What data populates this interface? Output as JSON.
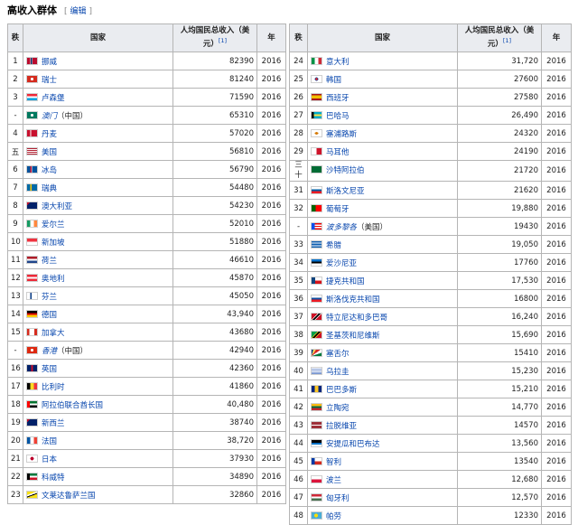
{
  "section": {
    "title": "高收入群体",
    "edit_open": "[",
    "edit_label": "编辑",
    "edit_close": "]"
  },
  "headers": {
    "rank": "秩",
    "country": "国家",
    "income": "人均国民总收入（美元）",
    "income_ref": "[1]",
    "year": "年"
  },
  "left_rows": [
    {
      "rank": "1",
      "country": "挪威",
      "income": "82390",
      "year": "2016",
      "flag": "linear-gradient(90deg,#ba0c2f 0 30%,#fff 30% 36%,#00205b 36% 48%,#fff 48% 54%,#ba0c2f 54%)"
    },
    {
      "rank": "2",
      "country": "瑞士",
      "income": "81240",
      "year": "2016",
      "flag": "radial-gradient(circle,#fff 0 25%,#d52b1e 26%)"
    },
    {
      "rank": "3",
      "country": "卢森堡",
      "income": "71590",
      "year": "2016",
      "flag": "linear-gradient(#ed2939 0 33%,#fff 33% 66%,#00a1de 66%)"
    },
    {
      "rank": "-",
      "country": "澳门",
      "italic": true,
      "note": "（中国）",
      "income": "65310",
      "year": "2016",
      "flag": "radial-gradient(circle,#fff 0 25%,#00785e 26%)"
    },
    {
      "rank": "4",
      "country": "丹麦",
      "income": "57020",
      "year": "2016",
      "flag": "linear-gradient(90deg,#c8102e 0 30%,#fff 30% 42%,#c8102e 42%)"
    },
    {
      "rank": "五",
      "country": "美国",
      "income": "56810",
      "year": "2016",
      "flag": "linear-gradient(#b22234 0 14%,#fff 14% 28%,#b22234 28% 42%,#fff 42% 57%,#b22234 57% 71%,#fff 71% 85%,#b22234 85%)"
    },
    {
      "rank": "6",
      "country": "冰岛",
      "income": "56790",
      "year": "2016",
      "flag": "linear-gradient(90deg,#02529c 0 30%,#fff 30% 34%,#dc1e35 34% 44%,#fff 44% 48%,#02529c 48%)"
    },
    {
      "rank": "7",
      "country": "瑞典",
      "income": "54480",
      "year": "2016",
      "flag": "linear-gradient(90deg,#006aa7 0 30%,#fecc00 30% 44%,#006aa7 44%)"
    },
    {
      "rank": "8",
      "country": "澳大利亚",
      "income": "54230",
      "year": "2016",
      "flag": "linear-gradient(135deg,#c8102e 0 18%,#012169 18%)"
    },
    {
      "rank": "9",
      "country": "爱尔兰",
      "income": "52010",
      "year": "2016",
      "flag": "linear-gradient(90deg,#169b62 0 33%,#fff 33% 66%,#ff883e 66%)"
    },
    {
      "rank": "10",
      "country": "新加坡",
      "income": "51880",
      "year": "2016",
      "flag": "linear-gradient(#ef3340 0 50%,#fff 50%)"
    },
    {
      "rank": "11",
      "country": "荷兰",
      "income": "46610",
      "year": "2016",
      "flag": "linear-gradient(#ae1c28 0 33%,#fff 33% 66%,#21468b 66%)"
    },
    {
      "rank": "12",
      "country": "奥地利",
      "income": "45870",
      "year": "2016",
      "flag": "linear-gradient(#ed2939 0 33%,#fff 33% 66%,#ed2939 66%)"
    },
    {
      "rank": "13",
      "country": "芬兰",
      "income": "45050",
      "year": "2016",
      "flag": "linear-gradient(90deg,#fff 0 30%,#003580 30% 44%,#fff 44%)"
    },
    {
      "rank": "14",
      "country": "德国",
      "income": "43,940",
      "year": "2016",
      "flag": "linear-gradient(#000 0 33%,#dd0000 33% 66%,#ffce00 66%)"
    },
    {
      "rank": "15",
      "country": "加拿大",
      "income": "43680",
      "year": "2016",
      "flag": "linear-gradient(90deg,#d52b1e 0 25%,#fff 25% 75%,#d52b1e 75%)"
    },
    {
      "rank": "-",
      "country": "香港",
      "italic": true,
      "note": "（中国）",
      "income": "42940",
      "year": "2016",
      "flag": "radial-gradient(circle,#fff 0 25%,#de2910 26%)"
    },
    {
      "rank": "16",
      "country": "英国",
      "income": "42360",
      "year": "2016",
      "flag": "linear-gradient(90deg,#012169 0 40%,#c8102e 40% 60%,#012169 60%)"
    },
    {
      "rank": "17",
      "country": "比利时",
      "income": "41860",
      "year": "2016",
      "flag": "linear-gradient(90deg,#000 0 33%,#fdda24 33% 66%,#ef3340 66%)"
    },
    {
      "rank": "18",
      "country": "阿拉伯联合酋长国",
      "income": "40,480",
      "year": "2016",
      "flag": "linear-gradient(90deg,#ff0000 0 26%,transparent 26%),linear-gradient(#00732f 0 33%,#fff 33% 66%,#000 66%)"
    },
    {
      "rank": "19",
      "country": "新西兰",
      "income": "38740",
      "year": "2016",
      "flag": "linear-gradient(135deg,#c8102e 0 18%,#012169 18%)"
    },
    {
      "rank": "20",
      "country": "法国",
      "income": "38,720",
      "year": "2016",
      "flag": "linear-gradient(90deg,#0055a4 0 33%,#fff 33% 66%,#ef4135 66%)"
    },
    {
      "rank": "21",
      "country": "日本",
      "income": "37930",
      "year": "2016",
      "flag": "radial-gradient(circle,#bc002d 0 28%,#fff 30%)"
    },
    {
      "rank": "22",
      "country": "科威特",
      "income": "34890",
      "year": "2016",
      "flag": "linear-gradient(90deg,#000 0 26%,transparent 26%),linear-gradient(#007a3d 0 33%,#fff 33% 66%,#ce1126 66%)"
    },
    {
      "rank": "23",
      "country": "文莱达鲁萨兰国",
      "income": "32860",
      "year": "2016",
      "flag": "linear-gradient(160deg,#f7e017 0 35%,#fff 35% 50%,#000 50% 60%,#f7e017 60%)"
    }
  ],
  "right_rows": [
    {
      "rank": "24",
      "country": "意大利",
      "income": "31,720",
      "year": "2016",
      "flag": "linear-gradient(90deg,#009246 0 33%,#fff 33% 66%,#ce2b37 66%)"
    },
    {
      "rank": "25",
      "country": "韩国",
      "income": "27600",
      "year": "2016",
      "flag": "radial-gradient(circle,#cd2e3a 0 20%,#0047a0 20% 28%,#fff 30%)"
    },
    {
      "rank": "26",
      "country": "西班牙",
      "income": "27580",
      "year": "2016",
      "flag": "linear-gradient(#aa151b 0 25%,#f1bf00 25% 75%,#aa151b 75%)"
    },
    {
      "rank": "27",
      "country": "巴哈马",
      "income": "26,490",
      "year": "2016",
      "flag": "linear-gradient(90deg,#000 0 25%,transparent 25%),linear-gradient(#00abc9 0 33%,#fae042 33% 66%,#00abc9 66%)"
    },
    {
      "rank": "28",
      "country": "塞浦路斯",
      "income": "24320",
      "year": "2016",
      "flag": "radial-gradient(ellipse,#d57800 0 25%,#fff 28%)"
    },
    {
      "rank": "29",
      "country": "马耳他",
      "income": "24190",
      "year": "2016",
      "flag": "linear-gradient(90deg,#fff 0 50%,#cf142b 50%)"
    },
    {
      "rank": "三十",
      "country": "沙特阿拉伯",
      "income": "21720",
      "year": "2016",
      "tall": true,
      "flag": "linear-gradient(#006c35 0 100%)"
    },
    {
      "rank": "31",
      "country": "斯洛文尼亚",
      "income": "21620",
      "year": "2016",
      "flag": "linear-gradient(#fff 0 33%,#005da4 33% 66%,#ed1c24 66%)"
    },
    {
      "rank": "32",
      "country": "葡萄牙",
      "income": "19,880",
      "year": "2016",
      "flag": "linear-gradient(90deg,#006600 0 40%,#ff0000 40%)"
    },
    {
      "rank": "-",
      "country": "波多黎各",
      "italic": true,
      "note": "（美国）",
      "income": "19430",
      "year": "2016",
      "flag": "linear-gradient(90deg,#0050f0 0 30%,transparent 30%),linear-gradient(#ed0000 0 20%,#fff 20% 40%,#ed0000 40% 60%,#fff 60% 80%,#ed0000 80%)"
    },
    {
      "rank": "33",
      "country": "希腊",
      "income": "19,050",
      "year": "2016",
      "flag": "linear-gradient(#0d5eaf 0 11%,#fff 11% 22%,#0d5eaf 22% 33%,#fff 33% 44%,#0d5eaf 44% 55%,#fff 55% 66%,#0d5eaf 66% 77%,#fff 77% 88%,#0d5eaf 88%)"
    },
    {
      "rank": "34",
      "country": "爱沙尼亚",
      "income": "17760",
      "year": "2016",
      "flag": "linear-gradient(#0072ce 0 33%,#000 33% 66%,#fff 66%)"
    },
    {
      "rank": "35",
      "country": "捷克共和国",
      "income": "17,530",
      "year": "2016",
      "flag": "linear-gradient(90deg,#11457e 0 35%,transparent 35%),linear-gradient(#fff 0 50%,#d7141a 50%)"
    },
    {
      "rank": "36",
      "country": "斯洛伐克共和国",
      "income": "16800",
      "year": "2016",
      "flag": "linear-gradient(#fff 0 33%,#0b4ea2 33% 66%,#ee1c25 66%)"
    },
    {
      "rank": "37",
      "country": "特立尼达和多巴哥",
      "income": "16,240",
      "year": "2016",
      "flag": "linear-gradient(135deg,#ce1126 0 38%,#fff 38% 42%,#000 42% 58%,#fff 58% 62%,#ce1126 62%)"
    },
    {
      "rank": "38",
      "country": "圣基茨和尼维斯",
      "income": "15,690",
      "year": "2016",
      "flag": "linear-gradient(135deg,#009e49 0 38%,#fcd116 38% 42%,#000 42% 58%,#fcd116 58% 62%,#ce1126 62%)"
    },
    {
      "rank": "39",
      "country": "塞舌尔",
      "income": "15410",
      "year": "2016",
      "flag": "conic-gradient(from 0deg at 0% 100%,#003f87 0 15deg,#fcd856 15deg 35deg,#d62828 35deg 55deg,#fff 55deg 72deg,#007a3d 72deg 90deg)"
    },
    {
      "rank": "40",
      "country": "乌拉圭",
      "income": "15,230",
      "year": "2016",
      "flag": "linear-gradient(#fff 0 20%,#0038a8 20% 30%,#fff 30% 50%,#0038a8 50% 60%,#fff 60% 80%,#0038a8 80% 90%,#fff 90%)"
    },
    {
      "rank": "41",
      "country": "巴巴多斯",
      "income": "15,210",
      "year": "2016",
      "flag": "linear-gradient(90deg,#00267f 0 33%,#ffc726 33% 66%,#00267f 66%)"
    },
    {
      "rank": "42",
      "country": "立陶宛",
      "income": "14,770",
      "year": "2016",
      "flag": "linear-gradient(#fdb913 0 33%,#006a44 33% 66%,#c1272d 66%)"
    },
    {
      "rank": "43",
      "country": "拉脱维亚",
      "income": "14570",
      "year": "2016",
      "flag": "linear-gradient(#9e3039 0 40%,#fff 40% 60%,#9e3039 60%)"
    },
    {
      "rank": "44",
      "country": "安提瓜和巴布达",
      "income": "13,560",
      "year": "2016",
      "flag": "linear-gradient(#000 0 40%,#0072c6 40% 70%,#fff 70%)"
    },
    {
      "rank": "45",
      "country": "智利",
      "income": "13540",
      "year": "2016",
      "flag": "linear-gradient(90deg,#0039a6 0 33%,transparent 33%),linear-gradient(#fff 0 50%,#d52b1e 50%)"
    },
    {
      "rank": "46",
      "country": "波兰",
      "income": "12,680",
      "year": "2016",
      "flag": "linear-gradient(#fff 0 50%,#dc143c 50%)"
    },
    {
      "rank": "47",
      "country": "匈牙利",
      "income": "12,570",
      "year": "2016",
      "flag": "linear-gradient(#ce2939 0 33%,#fff 33% 66%,#477050 66%)"
    },
    {
      "rank": "48",
      "country": "帕劳",
      "income": "12330",
      "year": "2016",
      "flag": "radial-gradient(circle at 45% 50%,#ffde00 0 28%,#4aadd6 30%)"
    }
  ]
}
